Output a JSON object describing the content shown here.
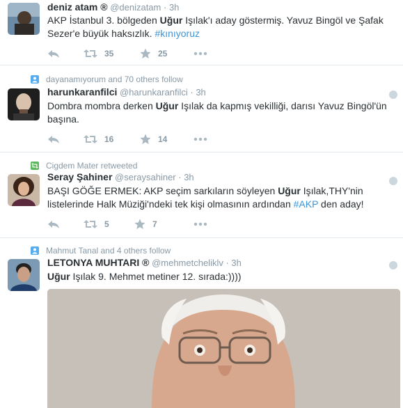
{
  "tweets": [
    {
      "name": "deniz atam ®",
      "handle": "@denizatam",
      "time": "· 3h",
      "text": [
        {
          "t": "AKP İstanbul 3. bölgeden "
        },
        {
          "t": "Uğur",
          "b": true
        },
        {
          "t": " Işılak'ı aday göstermiş. Yavuz Bingöl ve Şafak Sezer'e büyük haksızlık. "
        },
        {
          "t": "#kınıyoruz",
          "tag": true
        }
      ],
      "retweets": "35",
      "favorites": "25"
    },
    {
      "context": "dayanamıyorum and 70 others follow",
      "name": "harunkaranfilci",
      "handle": "@harunkaranfilci",
      "time": "· 3h",
      "text": [
        {
          "t": "Dombra mombra derken "
        },
        {
          "t": "Uğur",
          "b": true
        },
        {
          "t": " Işılak da kapmış vekilliği, darısı Yavuz Bingöl'ün başına."
        }
      ],
      "retweets": "16",
      "favorites": "14"
    },
    {
      "context": "Cigdem Mater retweeted",
      "name": "Seray Şahiner",
      "handle": "@seraysahiner",
      "time": "· 3h",
      "text": [
        {
          "t": "BAŞI GÖĞE ERMEK: AKP seçim sarkıların söyleyen "
        },
        {
          "t": "Uğur",
          "b": true
        },
        {
          "t": " Işılak,THY'nin listelerinde Halk Müziği'ndeki tek kişi olmasının ardından "
        },
        {
          "t": "#AKP",
          "tag": true
        },
        {
          "t": " den aday!"
        }
      ],
      "retweets": "5",
      "favorites": "7"
    },
    {
      "context": "Mahmut Tanal and 4 others follow",
      "name": "LETONYA MUHTARI ®",
      "handle": "@mehmetcheliklv",
      "time": "· 3h",
      "text": [
        {
          "t": "Uğur",
          "b": true
        },
        {
          "t": " Işılak 9. Mehmet metiner 12. sırada:))))"
        }
      ]
    }
  ],
  "colors": {
    "text": "#292f33",
    "muted": "#8899a6",
    "link": "#3b94d9",
    "follow_icon": "#55acee",
    "retweet_icon": "#5cb85c",
    "divider": "#e1e8ed"
  },
  "icons": {
    "reply": "reply-icon",
    "retweet": "retweet-icon",
    "favorite": "star-icon",
    "more": "more-icon",
    "options": "gear-icon",
    "follow_context": "person-icon",
    "retweet_context": "retweet-icon"
  }
}
